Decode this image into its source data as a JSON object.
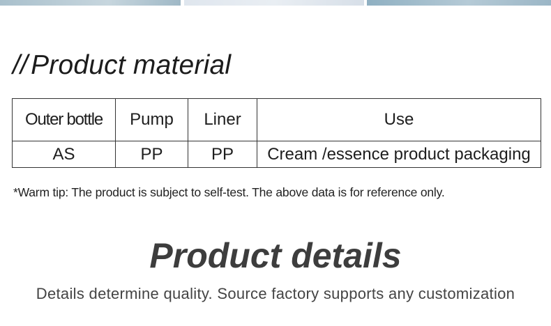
{
  "section_heading": {
    "prefix": "//",
    "title": "Product material"
  },
  "material_table": {
    "headers": [
      "Outer bottle",
      "Pump",
      "Liner",
      "Use"
    ],
    "row": [
      "AS",
      "PP",
      "PP",
      "Cream /essence product packaging"
    ]
  },
  "tip": "*Warm tip: The product is subject to self-test. The above data is for reference only.",
  "details": {
    "title": "Product details",
    "subtitle": "Details determine quality. Source factory supports any customization"
  }
}
